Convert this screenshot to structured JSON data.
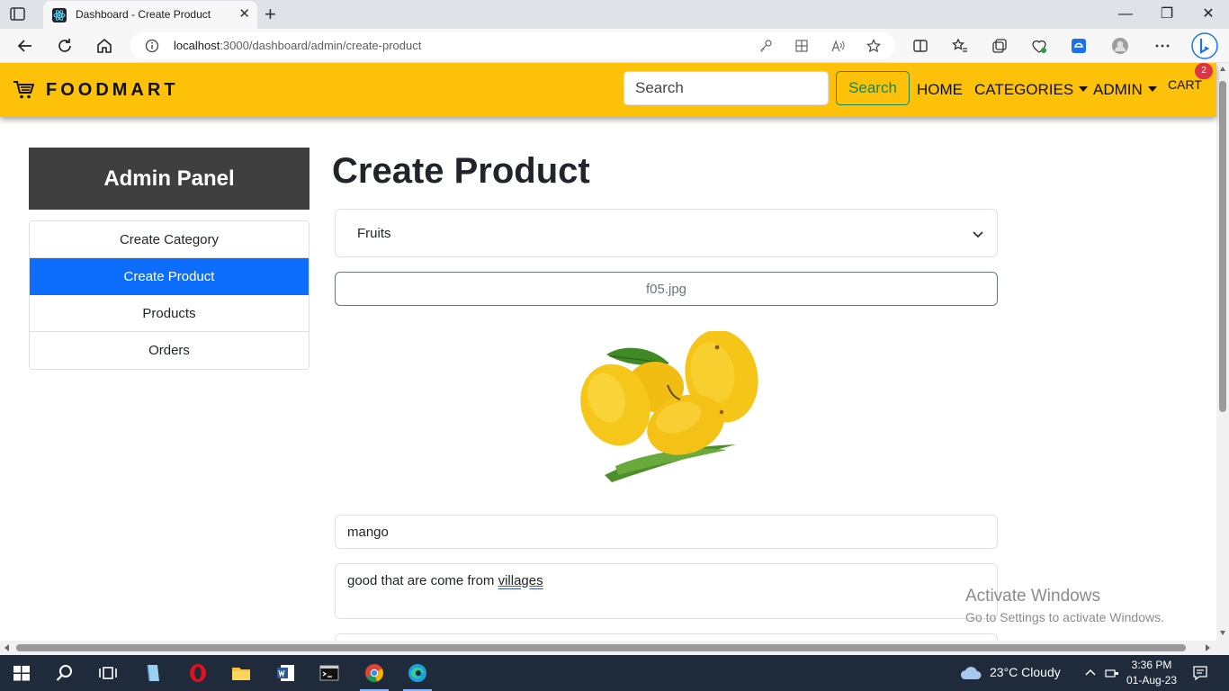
{
  "browser": {
    "tab_title": "Dashboard - Create Product",
    "url_host": "localhost",
    "url_path": ":3000/dashboard/admin/create-product"
  },
  "navbar": {
    "brand": "FOODMART",
    "search_placeholder": "Search",
    "search_button": "Search",
    "links": {
      "home": "HOME",
      "categories": "CATEGORIES",
      "admin": "ADMIN"
    },
    "cart_label": "CART",
    "cart_count": "2",
    "accent_color": "#fcc108"
  },
  "sidebar": {
    "heading": "Admin Panel",
    "items": [
      {
        "label": "Create Category",
        "active": false
      },
      {
        "label": "Create Product",
        "active": true
      },
      {
        "label": "Products",
        "active": false
      },
      {
        "label": "Orders",
        "active": false
      }
    ]
  },
  "form": {
    "title": "Create Product",
    "category_selected": "Fruits",
    "file_name": "f05.jpg",
    "preview_icon": "mango-photo",
    "name_value": "mango",
    "description_value_prefix": "good that are come from ",
    "description_value_misspelled": "villages"
  },
  "watermark": {
    "line1": "Activate Windows",
    "line2": "Go to Settings to activate Windows."
  },
  "taskbar": {
    "weather": "23°C  Cloudy",
    "time": "3:36 PM",
    "date": "01-Aug-23"
  }
}
